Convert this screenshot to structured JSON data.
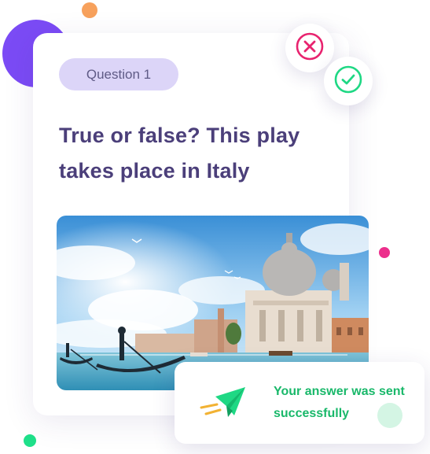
{
  "quiz": {
    "question_label": "Question 1",
    "question_text": "True or false? This play takes place in Italy"
  },
  "actions": {
    "false_icon": "x-circle-icon",
    "true_icon": "check-circle-icon"
  },
  "toast": {
    "message": "Your answer was sent successfully",
    "icon": "paper-plane-icon"
  },
  "colors": {
    "accent_purple": "#7b4bf5",
    "question_text": "#4b3f7a",
    "false_pink": "#e8236f",
    "true_green": "#1fd884",
    "success_green": "#19b86a"
  }
}
